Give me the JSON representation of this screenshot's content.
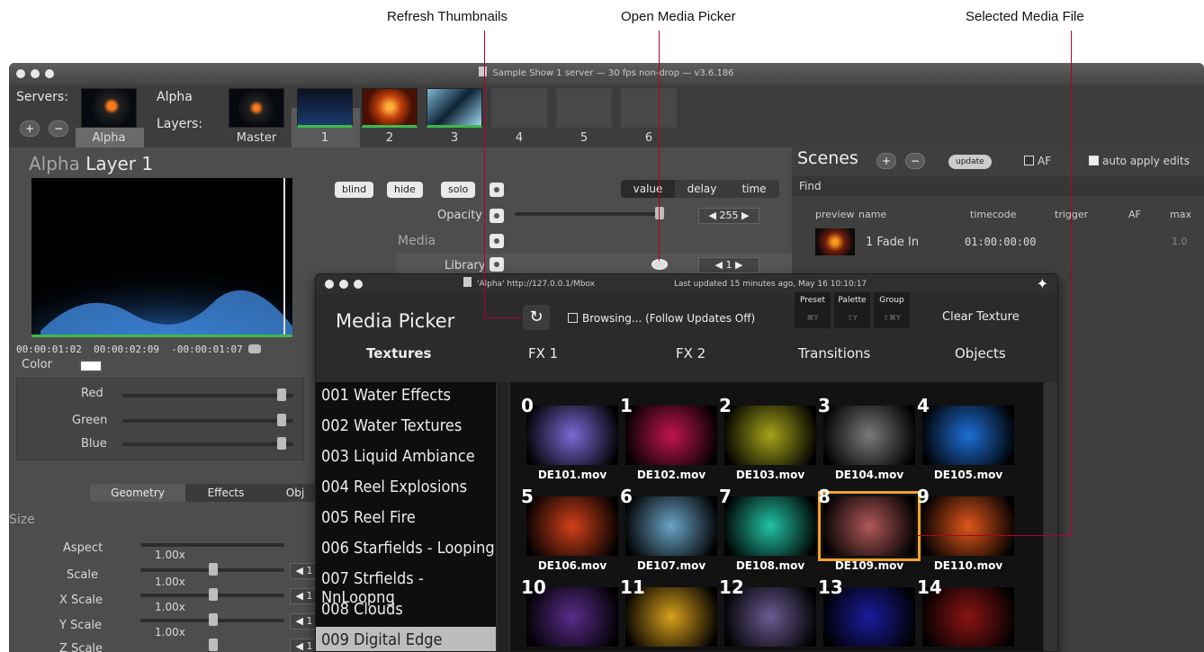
{
  "callouts": {
    "refresh": "Refresh Thumbnails",
    "open_picker": "Open Media Picker",
    "selected_file": "Selected Media File"
  },
  "main_window": {
    "title": "Sample Show 1 server  —  30 fps non-drop  —  v3.6.186",
    "servers_label": "Servers:",
    "server_name": "Alpha",
    "layers_title": "Alpha",
    "layers_label": "Layers:",
    "layer_tabs": [
      "Master",
      "1",
      "2",
      "3",
      "4",
      "5",
      "6"
    ]
  },
  "layer_panel": {
    "title_server": "Alpha",
    "title_layer": "Layer 1",
    "timecode_start": "00:00:01:02",
    "timecode_mid": "00:00:02:09",
    "timecode_remaining": "-00:00:01:07",
    "color_label": "Color",
    "buttons": {
      "blind": "blind",
      "hide": "hide",
      "solo": "solo"
    },
    "segments": [
      "value",
      "delay",
      "time"
    ],
    "opacity_label": "Opacity",
    "opacity_value": "255",
    "media_label": "Media",
    "library_label": "Library",
    "library_value": "1",
    "rgb": [
      {
        "label": "Red"
      },
      {
        "label": "Green"
      },
      {
        "label": "Blue"
      }
    ],
    "tabs": [
      "Geometry",
      "Effects",
      "Obj"
    ],
    "size_label": "Size",
    "geometry": [
      {
        "label": "Aspect",
        "value": "1.00x"
      },
      {
        "label": "Scale",
        "value": "1.00x"
      },
      {
        "label": "X Scale",
        "value": "1.00x"
      },
      {
        "label": "Y Scale",
        "value": "1.00x"
      },
      {
        "label": "Z Scale",
        "value": ""
      }
    ]
  },
  "scenes": {
    "title": "Scenes",
    "update_label": "update",
    "af_label": "AF",
    "auto_apply_label": "auto apply edits",
    "find_label": "Find",
    "columns": [
      "preview",
      "name",
      "timecode",
      "trigger",
      "AF",
      "max"
    ],
    "rows": [
      {
        "name": "1 Fade In",
        "timecode": "01:00:00:00",
        "max": "1.0"
      }
    ]
  },
  "media_picker": {
    "titlebar": "'Alpha' http://127.0.0.1/Mbox",
    "last_updated": "Last updated 15 minutes ago, May 16 10:10:17",
    "title": "Media Picker",
    "browsing": "Browsing... (Follow Updates Off)",
    "groups": [
      {
        "label": "Preset",
        "shortcut": "⌘Y"
      },
      {
        "label": "Palette",
        "shortcut": "⇧Y"
      },
      {
        "label": "Group",
        "shortcut": "⇧⌘Y"
      }
    ],
    "clear_texture": "Clear Texture",
    "tabs": [
      "Textures",
      "FX 1",
      "FX 2",
      "Transitions",
      "Objects"
    ],
    "folders": [
      "001 Water Effects",
      "002 Water Textures",
      "003 Liquid Ambiance",
      "004 Reel Explosions",
      "005 Reel Fire",
      "006 Starfields - Looping",
      "007 Strfields - NnLoopng",
      "008 Clouds",
      "009 Digital Edge"
    ],
    "selected_folder_index": 8,
    "files": [
      {
        "num": "0",
        "name": "DE101.mov",
        "color": "#7b6ad6"
      },
      {
        "num": "1",
        "name": "DE102.mov",
        "color": "#c0154e"
      },
      {
        "num": "2",
        "name": "DE103.mov",
        "color": "#a6a41a"
      },
      {
        "num": "3",
        "name": "DE104.mov",
        "color": "#7a7a7a"
      },
      {
        "num": "4",
        "name": "DE105.mov",
        "color": "#1e6fd6"
      },
      {
        "num": "5",
        "name": "DE106.mov",
        "color": "#d2401a"
      },
      {
        "num": "6",
        "name": "DE107.mov",
        "color": "#6aa4c8"
      },
      {
        "num": "7",
        "name": "DE108.mov",
        "color": "#22c3a4"
      },
      {
        "num": "8",
        "name": "DE109.mov",
        "color": "#b05858"
      },
      {
        "num": "9",
        "name": "DE110.mov",
        "color": "#e0561a"
      },
      {
        "num": "10",
        "name": "",
        "color": "#5a2c8a"
      },
      {
        "num": "11",
        "name": "",
        "color": "#d7a01c"
      },
      {
        "num": "12",
        "name": "",
        "color": "#6a5b92"
      },
      {
        "num": "13",
        "name": "",
        "color": "#1a1c9c"
      },
      {
        "num": "14",
        "name": "",
        "color": "#8b1414"
      }
    ],
    "selected_file_index": 8,
    "accent_color": "#f0a22a"
  }
}
